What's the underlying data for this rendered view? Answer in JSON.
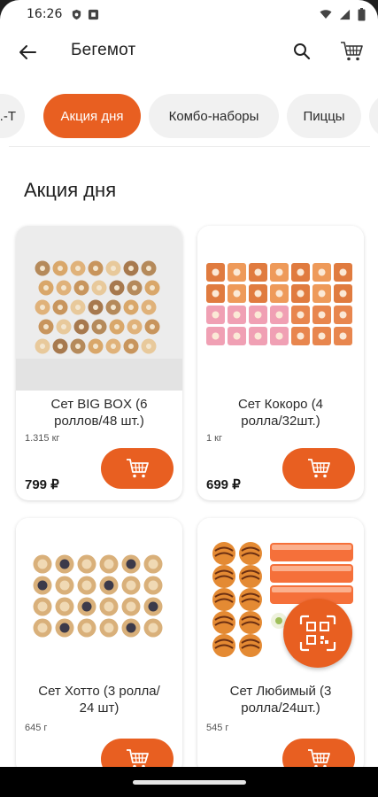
{
  "status_bar": {
    "time": "16:26"
  },
  "header": {
    "title": "Бегемот"
  },
  "categories": [
    {
      "label": "...-Т",
      "active": false
    },
    {
      "label": "Акция дня",
      "active": true
    },
    {
      "label": "Комбо-наборы",
      "active": false
    },
    {
      "label": "Пиццы",
      "active": false
    }
  ],
  "section": {
    "title": "Акция дня"
  },
  "products": [
    {
      "name": "Сет BIG BOX (6 роллов/48 шт.)",
      "name_line1": "Сет BIG BOX (6",
      "name_line2": "роллов/48 шт.)",
      "weight": "1.315 кг",
      "price": "799 ₽"
    },
    {
      "name": "Сет Кокоро (4 ролла/32шт.)",
      "name_line1": "Сет Кокоро  (4",
      "name_line2": "ролла/32шт.)",
      "weight": "1 кг",
      "price": "699 ₽"
    },
    {
      "name": "Сет Хотто (3 ролла/24 шт)",
      "name_line1": "Сет Хотто (3 ролла/",
      "name_line2": "24 шт)",
      "weight": "645 г",
      "price": ""
    },
    {
      "name": "Сет Любимый (3 ролла/24шт.)",
      "name_line1": "Сет Любимый (3",
      "name_line2": "ролла/24шт.)",
      "weight": "545 г",
      "price": ""
    }
  ],
  "colors": {
    "accent": "#e85f21",
    "chip_bg": "#f1f1f1"
  },
  "icons": {
    "back": "arrow-left-icon",
    "search": "search-icon",
    "cart": "cart-icon",
    "add_to_cart": "cart-add-icon",
    "qr": "qr-scan-icon"
  }
}
